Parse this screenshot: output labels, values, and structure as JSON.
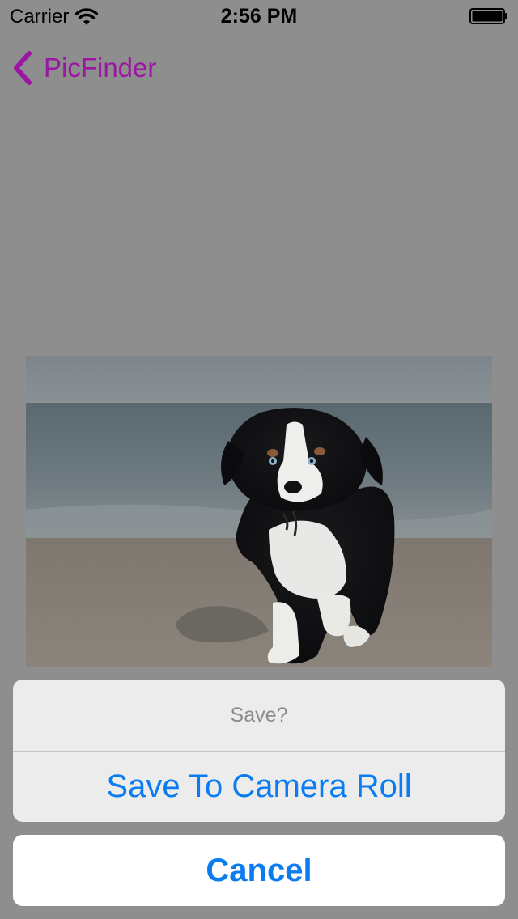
{
  "status_bar": {
    "carrier": "Carrier",
    "time": "2:56 PM",
    "icons": [
      "wifi-icon",
      "battery-icon"
    ]
  },
  "nav": {
    "back_label": "PicFinder",
    "back_icon": "chevron-left-icon"
  },
  "photo": {
    "description_icon": "dog-photo"
  },
  "action_sheet": {
    "title": "Save?",
    "actions": [
      {
        "label": "Save To Camera Roll"
      }
    ],
    "cancel_label": "Cancel"
  },
  "colors": {
    "accent_purple": "#9c16a4",
    "action_blue": "#0a7cf0",
    "dimmed_background": "#8e8e8e"
  }
}
